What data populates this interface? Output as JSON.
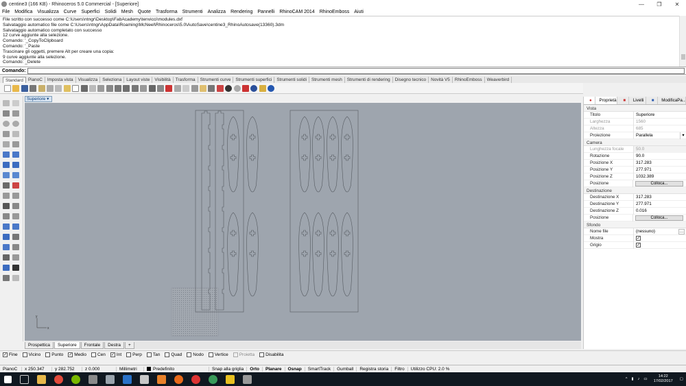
{
  "window": {
    "title": "centine3 (166 KB) - Rhinoceros 5.0 Commercial - [Superiore]",
    "min": "—",
    "max": "❐",
    "close": "✕"
  },
  "menu": [
    "File",
    "Modifica",
    "Visualizza",
    "Curve",
    "Superfici",
    "Solidi",
    "Mesh",
    "Quote",
    "Trasforma",
    "Strumenti",
    "Analizza",
    "Rendering",
    "Pannelli",
    "RhinoCAM 2014",
    "RhinoEmboss",
    "Aiuti"
  ],
  "history": [
    "File scritto con successo come C:\\Users\\ntngr\\Desktop\\FabAcademy\\tenvicci\\modules.dxf",
    "Salvataggio automatico file come C:\\Users\\ntngr\\AppData\\Roaming\\McNeel\\Rhinoceros\\5.0\\AutoSave\\centine3_RhinoAutosave(13360).3dm",
    "Salvataggio automatico completato con successo",
    "12 curve aggiunte alla selezione.",
    "Comando: '_CopyToClipboard",
    "Comando: '_Paste",
    "Trascinare gli oggetti, premere Alt per creare una copia:",
    "9 curve aggiunte alla selezione.",
    "Comando: _Delete"
  ],
  "command": {
    "label": "Comando:",
    "value": ""
  },
  "tabs": [
    "Standard",
    "PianoC",
    "Imposta vista",
    "Visualizza",
    "Seleziona",
    "Layout viste",
    "Visibilità",
    "Trasforma",
    "Strumenti curve",
    "Strumenti superfici",
    "Strumenti solidi",
    "Strumenti mesh",
    "Strumenti di rendering",
    "Disegno tecnico",
    "Novità V5",
    "RhinoEmboss",
    "Weaverbird"
  ],
  "viewport": {
    "label": "Superiore",
    "axis_y": "y",
    "axis_x": "x"
  },
  "viewport_tabs": [
    "Prospettica",
    "Superiore",
    "Frontale",
    "Destra",
    "+"
  ],
  "osnaps": [
    {
      "label": "Fine",
      "checked": "✓"
    },
    {
      "label": "Vicino",
      "checked": ""
    },
    {
      "label": "Punto",
      "checked": ""
    },
    {
      "label": "Medio",
      "checked": "✓"
    },
    {
      "label": "Cen",
      "checked": ""
    },
    {
      "label": "Int",
      "checked": "✓"
    },
    {
      "label": "Perp",
      "checked": ""
    },
    {
      "label": "Tan",
      "checked": ""
    },
    {
      "label": "Quad",
      "checked": ""
    },
    {
      "label": "Nodo",
      "checked": ""
    },
    {
      "label": "Vertice",
      "checked": ""
    },
    {
      "label": "Proietta",
      "checked": ""
    },
    {
      "label": "Disabilita",
      "checked": ""
    }
  ],
  "status": {
    "cplane": "PianoC",
    "x": "x 250.347",
    "y": "y 282.752",
    "z": "z 0.000",
    "units": "Millimetri",
    "layer": "Predefinito",
    "grid": "Snap alla griglia",
    "ortho": "Orto",
    "planar": "Planare",
    "osnap": "Osnap",
    "smarttrack": "SmartTrack",
    "gumball": "Gumball",
    "history": "Registra storia",
    "filter": "Filtro",
    "cpu": "Utilizzo CPU: 2.0 %"
  },
  "clock": {
    "time": "14:22",
    "date": "17/02/2017"
  },
  "panel": {
    "tabs": [
      "Proprietà",
      "Livelli",
      "ModificaPa..."
    ],
    "view_title": "Vista",
    "view_rows": [
      {
        "k": "Titolo",
        "v": "Superiore"
      },
      {
        "k": "Larghezza",
        "v": "1560"
      },
      {
        "k": "Altezza",
        "v": "685"
      },
      {
        "k": "Proiezione",
        "v": "Parallela"
      }
    ],
    "camera_title": "Camera",
    "camera_rows": [
      {
        "k": "Lunghezza focale",
        "v": "50.0"
      },
      {
        "k": "Rotazione",
        "v": "90.0"
      },
      {
        "k": "Posizione X",
        "v": "317.283"
      },
      {
        "k": "Posizione Y",
        "v": "277.971"
      },
      {
        "k": "Posizione Z",
        "v": "1032.389"
      },
      {
        "k": "Posizione",
        "v": "Colloca..."
      }
    ],
    "target_title": "Destinazione",
    "target_rows": [
      {
        "k": "Destinazione X",
        "v": "317.283"
      },
      {
        "k": "Destinazione Y",
        "v": "277.971"
      },
      {
        "k": "Destinazione Z",
        "v": "0.016"
      },
      {
        "k": "Posizione",
        "v": "Colloca..."
      }
    ],
    "bg_title": "Sfondo",
    "bg_rows": [
      {
        "k": "Nome file",
        "v": "(nessuno)"
      },
      {
        "k": "Mostra",
        "v": "✓"
      },
      {
        "k": "Grigio",
        "v": "✓"
      }
    ]
  }
}
